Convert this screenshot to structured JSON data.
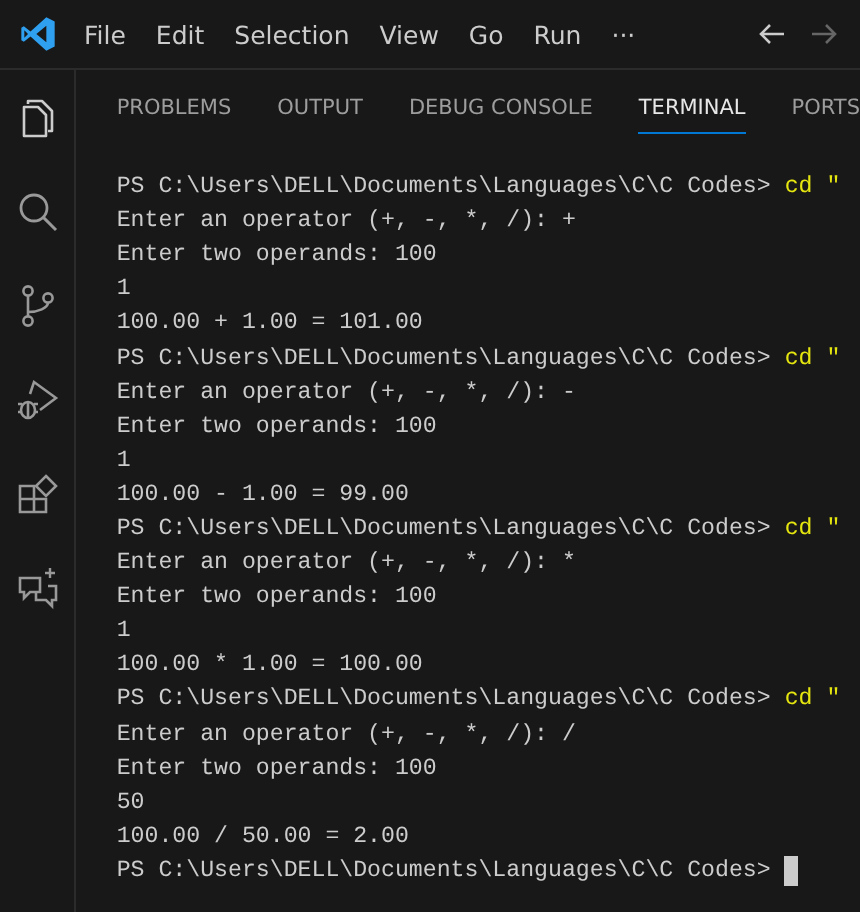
{
  "menu": [
    "File",
    "Edit",
    "Selection",
    "View",
    "Go",
    "Run",
    "···"
  ],
  "panel_tabs": [
    {
      "label": "PROBLEMS",
      "selected": false
    },
    {
      "label": "OUTPUT",
      "selected": false
    },
    {
      "label": "DEBUG CONSOLE",
      "selected": false
    },
    {
      "label": "TERMINAL",
      "selected": true
    },
    {
      "label": "PORTS",
      "selected": false
    }
  ],
  "terminal": {
    "lines": [
      {
        "kind": "prompt",
        "text": "PS C:\\Users\\DELL\\Documents\\Languages\\C\\C Codes>",
        "command": "cd \""
      },
      {
        "kind": "output",
        "text": "Enter an operator (+, -, *, /): +"
      },
      {
        "kind": "output",
        "text": "Enter two operands: 100"
      },
      {
        "kind": "output",
        "text": "1"
      },
      {
        "kind": "output",
        "text": "100.00 + 1.00 = 101.00"
      },
      {
        "kind": "prompt",
        "text": "PS C:\\Users\\DELL\\Documents\\Languages\\C\\C Codes>",
        "command": "cd \""
      },
      {
        "kind": "output",
        "text": "Enter an operator (+, -, *, /): -"
      },
      {
        "kind": "output",
        "text": "Enter two operands: 100"
      },
      {
        "kind": "output",
        "text": "1"
      },
      {
        "kind": "output",
        "text": "100.00 - 1.00 = 99.00"
      },
      {
        "kind": "prompt",
        "text": "PS C:\\Users\\DELL\\Documents\\Languages\\C\\C Codes>",
        "command": "cd \""
      },
      {
        "kind": "output",
        "text": "Enter an operator (+, -, *, /): *"
      },
      {
        "kind": "output",
        "text": "Enter two operands: 100"
      },
      {
        "kind": "output",
        "text": "1"
      },
      {
        "kind": "output",
        "text": "100.00 * 1.00 = 100.00"
      },
      {
        "kind": "prompt",
        "text": "PS C:\\Users\\DELL\\Documents\\Languages\\C\\C Codes>",
        "command": "cd \""
      },
      {
        "kind": "output",
        "text": "Enter an operator (+, -, *, /): /"
      },
      {
        "kind": "output",
        "text": "Enter two operands: 100"
      },
      {
        "kind": "output",
        "text": "50"
      },
      {
        "kind": "output",
        "text": "100.00 / 50.00 = 2.00"
      },
      {
        "kind": "cursor",
        "text": "PS C:\\Users\\DELL\\Documents\\Languages\\C\\C Codes>"
      }
    ]
  }
}
